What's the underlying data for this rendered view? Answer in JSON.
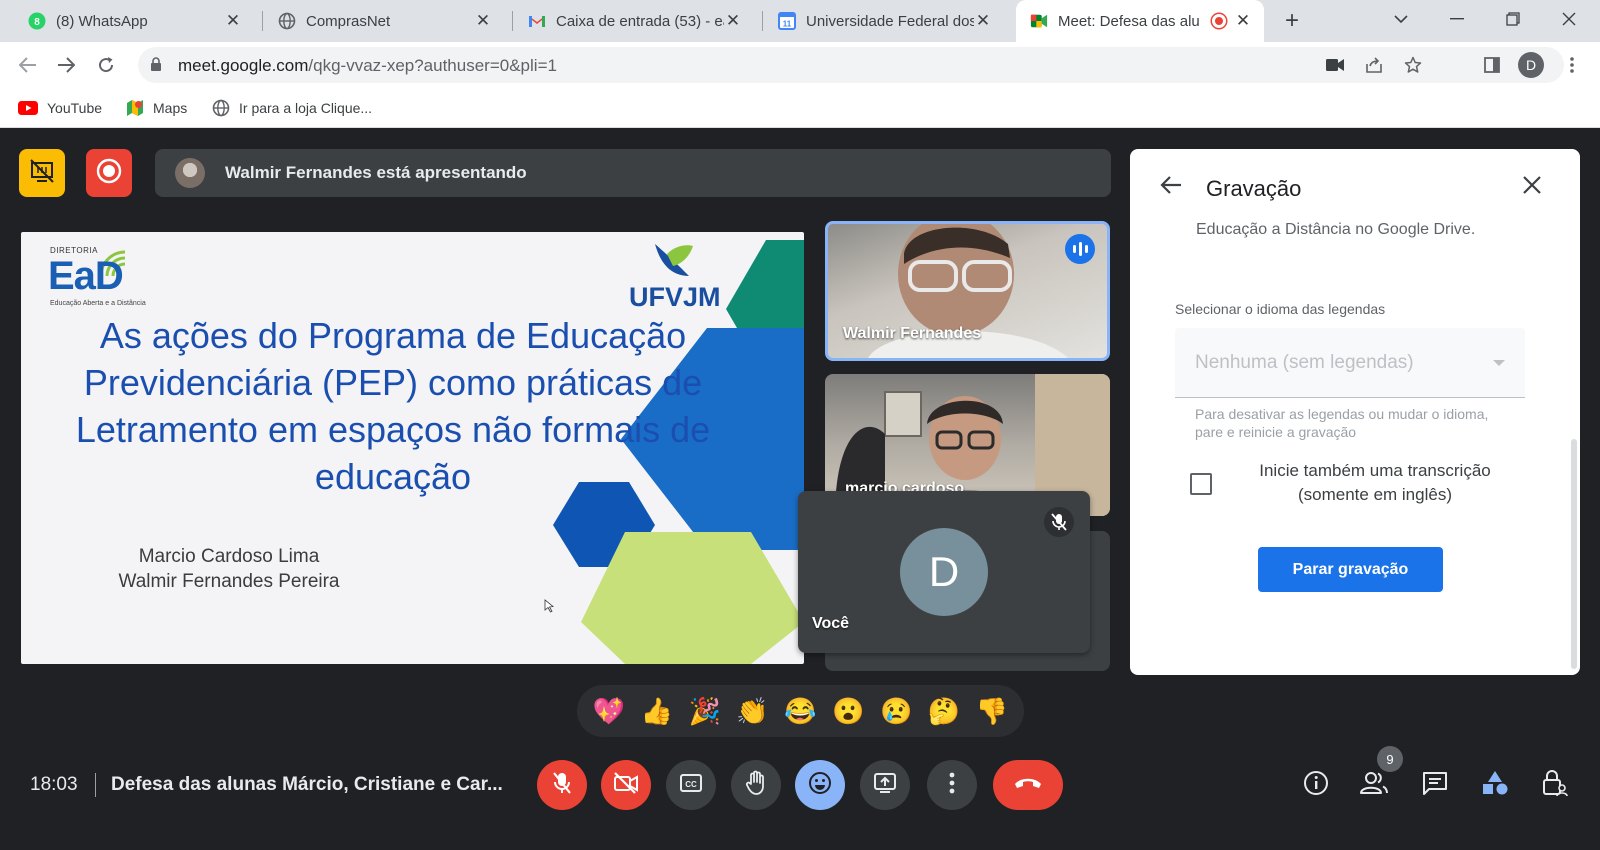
{
  "browser": {
    "tabs": [
      {
        "title": "(8) WhatsApp",
        "icon": "whatsapp-icon"
      },
      {
        "title": "ComprasNet",
        "icon": "globe-icon"
      },
      {
        "title": "Caixa de entrada (53) - ea",
        "icon": "gmail-icon"
      },
      {
        "title": "Universidade Federal dos",
        "icon": "calendar-icon"
      },
      {
        "title": "Meet: Defesa das alu",
        "icon": "meet-icon"
      }
    ],
    "url_host": "meet.google.com",
    "url_path": "/qkg-vvaz-xep?authuser=0&pli=1",
    "profile_initial": "D",
    "bookmarks": [
      {
        "label": "YouTube",
        "icon": "youtube-icon"
      },
      {
        "label": "Maps",
        "icon": "maps-icon"
      },
      {
        "label": "Ir para a loja Clique...",
        "icon": "globe-icon"
      }
    ]
  },
  "meet": {
    "presenting_text": "Walmir Fernandes está apresentando",
    "slide": {
      "diretoria": "DIRETORIA",
      "ead": "EaD",
      "ead_sub": "Educação Aberta e a Distância",
      "ufvjm": "UFVJM",
      "headline": "As ações do Programa de Educação Previdenciária (PEP) como práticas de Letramento em espaços não formais de educação",
      "author1": "Marcio Cardoso Lima",
      "author2": "Walmir Fernandes Pereira"
    },
    "participants": {
      "walmir": "Walmir Fernandes",
      "marcio": "marcio cardoso",
      "voce": "Você",
      "voce_initial": "D"
    },
    "panel": {
      "title": "Gravação",
      "cut_text": "Educação a Distância no Google Drive.",
      "caption_label": "Selecionar o idioma das legendas",
      "caption_value": "Nenhuma (sem legendas)",
      "hint": "Para desativar as legendas ou mudar o idioma, pare e reinicie a gravação",
      "transcript_label": "Inicie também uma transcrição (somente em inglês)",
      "stop_button": "Parar gravação"
    },
    "reactions": [
      "💖",
      "👍",
      "🎉",
      "👏",
      "😂",
      "😮",
      "😢",
      "🤔",
      "👎"
    ],
    "clock": "18:03",
    "meeting_name": "Defesa das alunas Márcio, Cristiane e Car...",
    "people_count": "9",
    "colors": {
      "accent_blue": "#1a73e8",
      "danger_red": "#ea4335",
      "dark_bg": "#202124",
      "tile_gray": "#3c4043",
      "warning_yellow": "#fbbc04"
    }
  }
}
